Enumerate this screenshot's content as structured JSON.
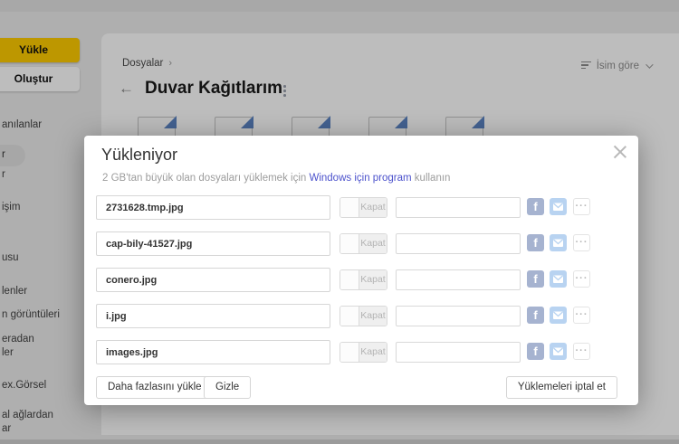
{
  "sidebar": {
    "upload_button": "Yükle",
    "create_button": "Oluştur",
    "items": [
      {
        "line1": "anılanlar"
      },
      {
        "line1": "r",
        "selected": true
      },
      {
        "line1": "r"
      },
      {
        "line1": "işim"
      },
      {
        "line1": "usu"
      },
      {
        "line1": "lenler"
      },
      {
        "line1": "n görüntüleri"
      },
      {
        "line1": "eradan",
        "line2": "ler"
      },
      {
        "line1": "ex.Görsel"
      },
      {
        "line1": "al ağlardan",
        "line2": "ar"
      }
    ]
  },
  "content": {
    "breadcrumb": "Dosyalar",
    "breadcrumb_chevron": "›",
    "back_arrow": "←",
    "title": "Duvar Kağıtlarım",
    "sort_label": "İsim göre"
  },
  "modal": {
    "title": "Yükleniyor",
    "note_prefix": "2 GB'tan büyük olan dosyaları yüklemek için ",
    "note_link": "Windows için program",
    "note_suffix": " kullanın",
    "row_close_label": "Kapat",
    "files": [
      "2731628.tmp.jpg",
      "cap-bily-41527.jpg",
      "conero.jpg",
      "i.jpg",
      "images.jpg"
    ],
    "actions": {
      "upload_more": "Daha fazlasını yükle",
      "hide": "Gizle",
      "cancel_all": "Yüklemeleri iptal et"
    }
  },
  "icons": {
    "remove": "×",
    "facebook": "f",
    "more": "···"
  },
  "colors": {
    "accent_yellow": "#ffcc00",
    "link_blue": "#4c52cc",
    "facebook_blue": "#3b5998",
    "mail_blue": "#4f94de",
    "file_icon_blue": "#3f6cb4",
    "file_icon_yellow": "#f0c000"
  }
}
